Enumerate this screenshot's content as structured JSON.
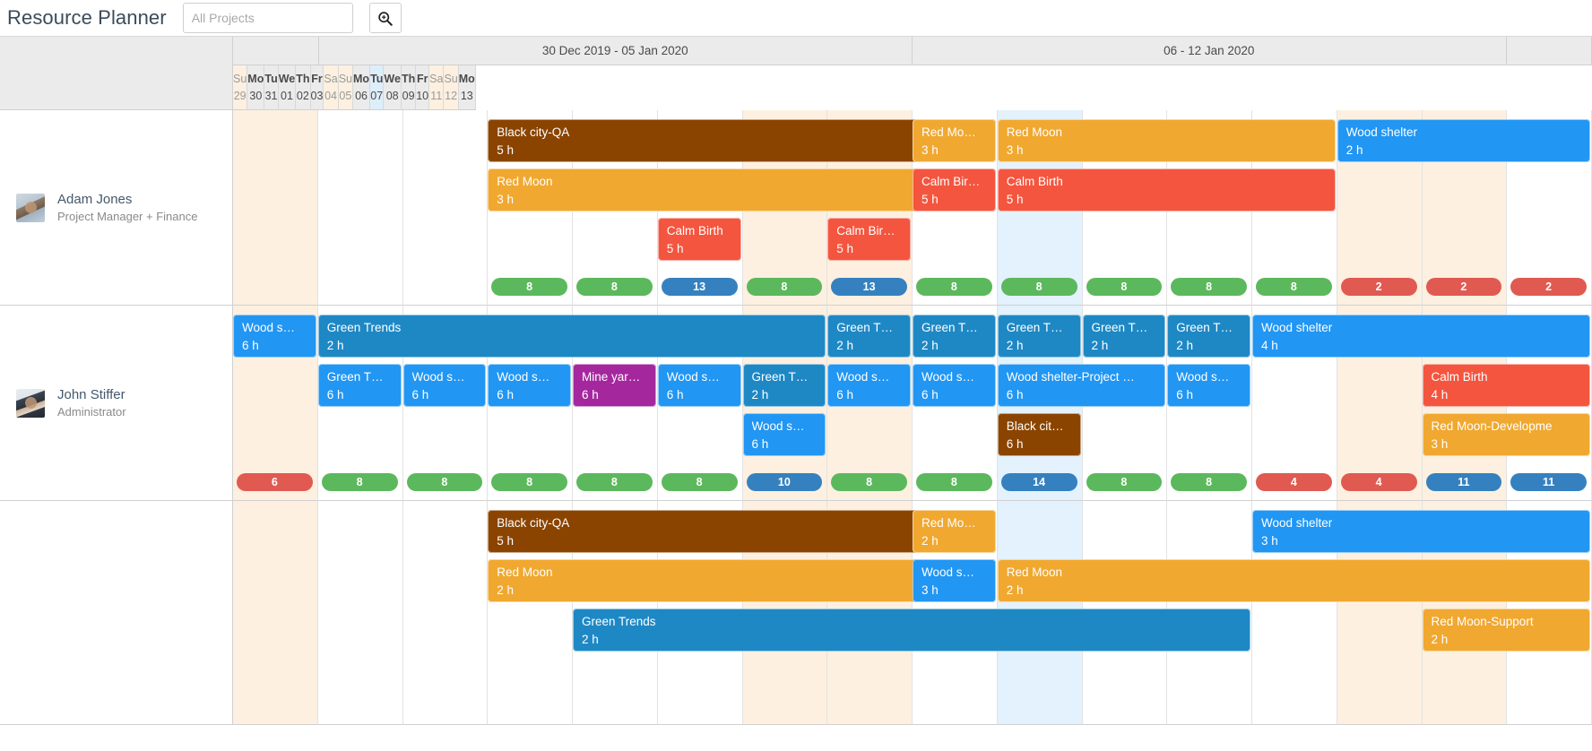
{
  "header": {
    "title": "Resource Planner",
    "filter_placeholder": "All Projects",
    "filter_value": "",
    "search_icon": "search-zoom-icon"
  },
  "colors": {
    "brown": "#8a4400",
    "orange": "#f0a830",
    "red": "#f4553f",
    "blue": "#2196f3",
    "teal_blue": "#1e88c5",
    "purple": "#a5279e",
    "badge_green": "#5cb85c",
    "badge_blue": "#3581c0",
    "badge_red": "#e05a52",
    "weekend_bg": "#fdf0e0",
    "today_bg": "#e3f2fc",
    "header_bg": "#ebebeb"
  },
  "timeline": {
    "weeks": [
      {
        "label": "",
        "span": 1
      },
      {
        "label": "30 Dec 2019 - 05 Jan 2020",
        "span": 7
      },
      {
        "label": "06 - 12 Jan 2020",
        "span": 7
      },
      {
        "label": "",
        "span": 1
      }
    ],
    "days": [
      {
        "dow": "Su",
        "num": "29",
        "weekend": true,
        "today": false
      },
      {
        "dow": "Mo",
        "num": "30",
        "weekend": false,
        "today": false
      },
      {
        "dow": "Tu",
        "num": "31",
        "weekend": false,
        "today": false
      },
      {
        "dow": "We",
        "num": "01",
        "weekend": false,
        "today": false
      },
      {
        "dow": "Th",
        "num": "02",
        "weekend": false,
        "today": false
      },
      {
        "dow": "Fr",
        "num": "03",
        "weekend": false,
        "today": false
      },
      {
        "dow": "Sa",
        "num": "04",
        "weekend": true,
        "today": false
      },
      {
        "dow": "Su",
        "num": "05",
        "weekend": true,
        "today": false
      },
      {
        "dow": "Mo",
        "num": "06",
        "weekend": false,
        "today": false
      },
      {
        "dow": "Tu",
        "num": "07",
        "weekend": false,
        "today": true
      },
      {
        "dow": "We",
        "num": "08",
        "weekend": false,
        "today": false
      },
      {
        "dow": "Th",
        "num": "09",
        "weekend": false,
        "today": false
      },
      {
        "dow": "Fr",
        "num": "10",
        "weekend": false,
        "today": false
      },
      {
        "dow": "Sa",
        "num": "11",
        "weekend": true,
        "today": false
      },
      {
        "dow": "Su",
        "num": "12",
        "weekend": true,
        "today": false
      },
      {
        "dow": "Mo",
        "num": "13",
        "weekend": false,
        "today": false
      }
    ]
  },
  "resources": [
    {
      "name": "Adam Jones",
      "role": "Project Manager + Finance",
      "avatar": "adam-jones-avatar",
      "tasks": [
        {
          "title": "Black city-QA",
          "hours": "5 h",
          "color": "brown",
          "start": 3,
          "span": 6,
          "lane": 0
        },
        {
          "title": "Red Mo…",
          "hours": "3 h",
          "color": "orange",
          "start": 8,
          "span": 1,
          "lane": 0
        },
        {
          "title": "Red Moon",
          "hours": "3 h",
          "color": "orange",
          "start": 9,
          "span": 4,
          "lane": 0
        },
        {
          "title": "Wood shelter",
          "hours": "2 h",
          "color": "blue",
          "start": 13,
          "span": 3,
          "lane": 0
        },
        {
          "title": "Red Moon",
          "hours": "3 h",
          "color": "orange",
          "start": 3,
          "span": 6,
          "lane": 1
        },
        {
          "title": "Calm Bir…",
          "hours": "5 h",
          "color": "red",
          "start": 8,
          "span": 1,
          "lane": 1
        },
        {
          "title": "Calm Birth",
          "hours": "5 h",
          "color": "red",
          "start": 9,
          "span": 4,
          "lane": 1
        },
        {
          "title": "Calm Birth",
          "hours": "5 h",
          "color": "red",
          "start": 5,
          "span": 1,
          "lane": 2
        },
        {
          "title": "Calm Bir…",
          "hours": "5 h",
          "color": "red",
          "start": 7,
          "span": 1,
          "lane": 2
        }
      ],
      "badges": [
        {
          "day": 3,
          "value": "8",
          "color": "green"
        },
        {
          "day": 4,
          "value": "8",
          "color": "green"
        },
        {
          "day": 5,
          "value": "13",
          "color": "blue"
        },
        {
          "day": 6,
          "value": "8",
          "color": "green"
        },
        {
          "day": 7,
          "value": "13",
          "color": "blue"
        },
        {
          "day": 8,
          "value": "8",
          "color": "green"
        },
        {
          "day": 9,
          "value": "8",
          "color": "green"
        },
        {
          "day": 10,
          "value": "8",
          "color": "green"
        },
        {
          "day": 11,
          "value": "8",
          "color": "green"
        },
        {
          "day": 12,
          "value": "8",
          "color": "green"
        },
        {
          "day": 13,
          "value": "2",
          "color": "red"
        },
        {
          "day": 14,
          "value": "2",
          "color": "red"
        },
        {
          "day": 15,
          "value": "2",
          "color": "red"
        }
      ]
    },
    {
      "name": "John Stiffer",
      "role": "Administrator",
      "avatar": "john-stiffer-avatar",
      "tasks": [
        {
          "title": "Wood s…",
          "hours": "6 h",
          "color": "blue",
          "start": 0,
          "span": 1,
          "lane": 0
        },
        {
          "title": "Green Trends",
          "hours": "2 h",
          "color": "teal_blue",
          "start": 1,
          "span": 6,
          "lane": 0
        },
        {
          "title": "Green T…",
          "hours": "2 h",
          "color": "teal_blue",
          "start": 7,
          "span": 1,
          "lane": 0
        },
        {
          "title": "Green T…",
          "hours": "2 h",
          "color": "teal_blue",
          "start": 8,
          "span": 1,
          "lane": 0
        },
        {
          "title": "Green T…",
          "hours": "2 h",
          "color": "teal_blue",
          "start": 9,
          "span": 1,
          "lane": 0
        },
        {
          "title": "Green T…",
          "hours": "2 h",
          "color": "teal_blue",
          "start": 10,
          "span": 1,
          "lane": 0
        },
        {
          "title": "Green T…",
          "hours": "2 h",
          "color": "teal_blue",
          "start": 11,
          "span": 1,
          "lane": 0
        },
        {
          "title": "Wood shelter",
          "hours": "4 h",
          "color": "blue",
          "start": 12,
          "span": 4,
          "lane": 0
        },
        {
          "title": "Green T…",
          "hours": "6 h",
          "color": "blue",
          "start": 1,
          "span": 1,
          "lane": 1
        },
        {
          "title": "Wood s…",
          "hours": "6 h",
          "color": "blue",
          "start": 2,
          "span": 1,
          "lane": 1
        },
        {
          "title": "Wood s…",
          "hours": "6 h",
          "color": "blue",
          "start": 3,
          "span": 1,
          "lane": 1
        },
        {
          "title": "Mine yar…",
          "hours": "6 h",
          "color": "purple",
          "start": 4,
          "span": 1,
          "lane": 1
        },
        {
          "title": "Wood s…",
          "hours": "6 h",
          "color": "blue",
          "start": 5,
          "span": 1,
          "lane": 1
        },
        {
          "title": "Green T…",
          "hours": "2 h",
          "color": "teal_blue",
          "start": 6,
          "span": 1,
          "lane": 1
        },
        {
          "title": "Wood s…",
          "hours": "6 h",
          "color": "blue",
          "start": 7,
          "span": 1,
          "lane": 1
        },
        {
          "title": "Wood s…",
          "hours": "6 h",
          "color": "blue",
          "start": 8,
          "span": 1,
          "lane": 1
        },
        {
          "title": "Wood shelter-Project …",
          "hours": "6 h",
          "color": "blue",
          "start": 9,
          "span": 2,
          "lane": 1
        },
        {
          "title": "Wood s…",
          "hours": "6 h",
          "color": "blue",
          "start": 11,
          "span": 1,
          "lane": 1
        },
        {
          "title": "Calm Birth",
          "hours": "4 h",
          "color": "red",
          "start": 14,
          "span": 2,
          "lane": 1
        },
        {
          "title": "Wood s…",
          "hours": "6 h",
          "color": "blue",
          "start": 6,
          "span": 1,
          "lane": 2
        },
        {
          "title": "Black cit…",
          "hours": "6 h",
          "color": "brown",
          "start": 9,
          "span": 1,
          "lane": 2
        },
        {
          "title": "Red Moon-Developme",
          "hours": "3 h",
          "color": "orange",
          "start": 14,
          "span": 2,
          "lane": 2
        }
      ],
      "badges": [
        {
          "day": 0,
          "value": "6",
          "color": "red"
        },
        {
          "day": 1,
          "value": "8",
          "color": "green"
        },
        {
          "day": 2,
          "value": "8",
          "color": "green"
        },
        {
          "day": 3,
          "value": "8",
          "color": "green"
        },
        {
          "day": 4,
          "value": "8",
          "color": "green"
        },
        {
          "day": 5,
          "value": "8",
          "color": "green"
        },
        {
          "day": 6,
          "value": "10",
          "color": "blue"
        },
        {
          "day": 7,
          "value": "8",
          "color": "green"
        },
        {
          "day": 8,
          "value": "8",
          "color": "green"
        },
        {
          "day": 9,
          "value": "14",
          "color": "blue"
        },
        {
          "day": 10,
          "value": "8",
          "color": "green"
        },
        {
          "day": 11,
          "value": "8",
          "color": "green"
        },
        {
          "day": 12,
          "value": "4",
          "color": "red"
        },
        {
          "day": 13,
          "value": "4",
          "color": "red"
        },
        {
          "day": 14,
          "value": "11",
          "color": "blue"
        },
        {
          "day": 15,
          "value": "11",
          "color": "blue"
        }
      ]
    },
    {
      "name": "",
      "role": "",
      "avatar": "",
      "tasks": [
        {
          "title": "Black city-QA",
          "hours": "5 h",
          "color": "brown",
          "start": 3,
          "span": 6,
          "lane": 0
        },
        {
          "title": "Red Mo…",
          "hours": "2 h",
          "color": "orange",
          "start": 8,
          "span": 1,
          "lane": 0
        },
        {
          "title": "Wood shelter",
          "hours": "3 h",
          "color": "blue",
          "start": 12,
          "span": 4,
          "lane": 0
        },
        {
          "title": "Red Moon",
          "hours": "2 h",
          "color": "orange",
          "start": 3,
          "span": 6,
          "lane": 1
        },
        {
          "title": "Wood s…",
          "hours": "3 h",
          "color": "blue",
          "start": 8,
          "span": 1,
          "lane": 1
        },
        {
          "title": "Red Moon",
          "hours": "2 h",
          "color": "orange",
          "start": 9,
          "span": 7,
          "lane": 1
        },
        {
          "title": "Green Trends",
          "hours": "2 h",
          "color": "teal_blue",
          "start": 4,
          "span": 8,
          "lane": 2
        },
        {
          "title": "Red Moon-Support",
          "hours": "2 h",
          "color": "orange",
          "start": 14,
          "span": 2,
          "lane": 2
        }
      ],
      "badges": []
    }
  ]
}
